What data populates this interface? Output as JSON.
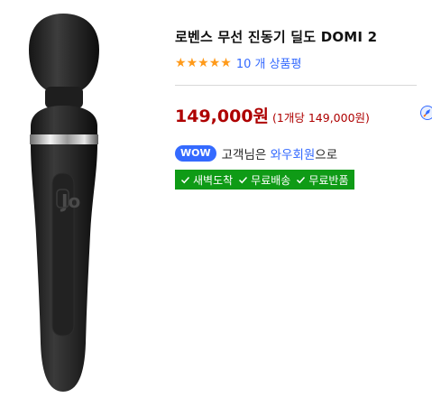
{
  "product": {
    "title": "로벤스 무선 진동기 딜도 DOMI 2",
    "rating_stars": 5,
    "review_count_text": "10 개 상품평",
    "price": "149,000원",
    "unit_price": "(1개당 149,000원)"
  },
  "membership": {
    "badge": "WOW",
    "text_prefix": "고객님은 ",
    "member_label": "와우회원",
    "text_suffix": "으로"
  },
  "benefits": [
    {
      "label": "새벽도착",
      "icon": "check-icon"
    },
    {
      "label": "무료배송",
      "icon": "check-icon"
    },
    {
      "label": "무료반품",
      "icon": "check-icon"
    }
  ],
  "colors": {
    "price": "#ae0000",
    "link": "#346aff",
    "star": "#ff9a1a",
    "benefit_bg": "#0f9b16"
  }
}
